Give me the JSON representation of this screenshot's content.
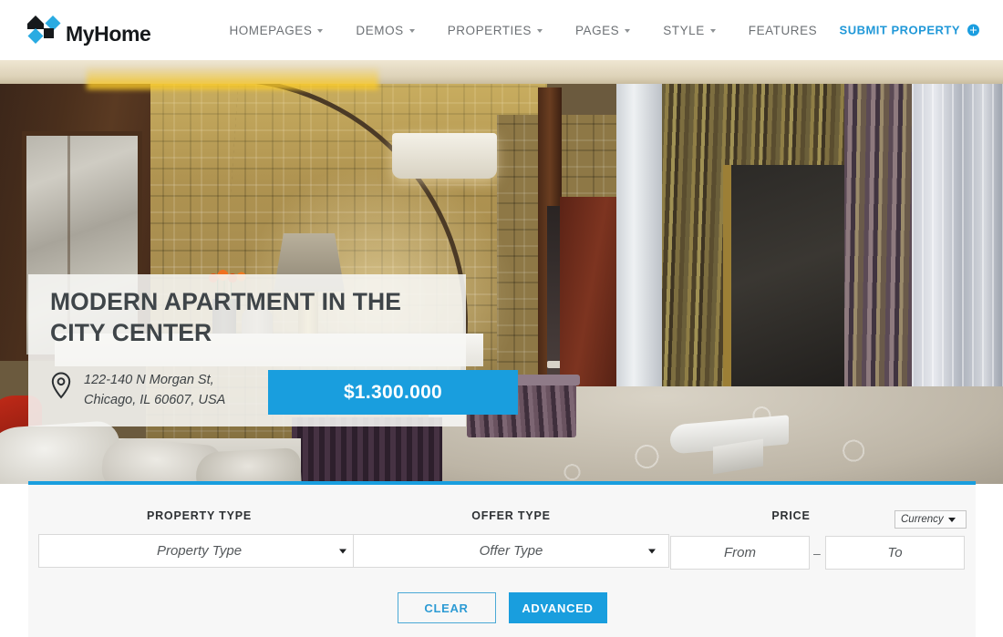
{
  "brand": {
    "name": "MyHome",
    "logo_icon": "house-diamond-logo",
    "colors": {
      "accent": "#199ede",
      "logo_blue": "#29abe2",
      "logo_dark": "#16191c"
    }
  },
  "header": {
    "nav": [
      {
        "label": "HOMEPAGES",
        "has_dropdown": true
      },
      {
        "label": "DEMOS",
        "has_dropdown": true
      },
      {
        "label": "PROPERTIES",
        "has_dropdown": true
      },
      {
        "label": "PAGES",
        "has_dropdown": true
      },
      {
        "label": "STYLE",
        "has_dropdown": true
      },
      {
        "label": "FEATURES",
        "has_dropdown": false
      }
    ],
    "submit_property": {
      "label": "SUBMIT PROPERTY",
      "icon": "plus-circle-icon"
    }
  },
  "hero": {
    "title": "MODERN APARTMENT IN THE CITY CENTER",
    "location_icon": "map-pin-icon",
    "address": "122-140 N Morgan St,\nChicago, IL 60607, USA",
    "price": "$1.300.000"
  },
  "search": {
    "property_type": {
      "label": "PROPERTY TYPE",
      "placeholder": "Property Type",
      "icon": "chevron-down-icon"
    },
    "offer_type": {
      "label": "OFFER TYPE",
      "placeholder": "Offer Type",
      "icon": "chevron-down-icon"
    },
    "price": {
      "label": "PRICE",
      "from_placeholder": "From",
      "to_placeholder": "To",
      "separator": "–"
    },
    "currency": {
      "label": "Currency",
      "icon": "chevron-down-icon"
    },
    "buttons": {
      "clear": "CLEAR",
      "advanced": "ADVANCED"
    }
  }
}
